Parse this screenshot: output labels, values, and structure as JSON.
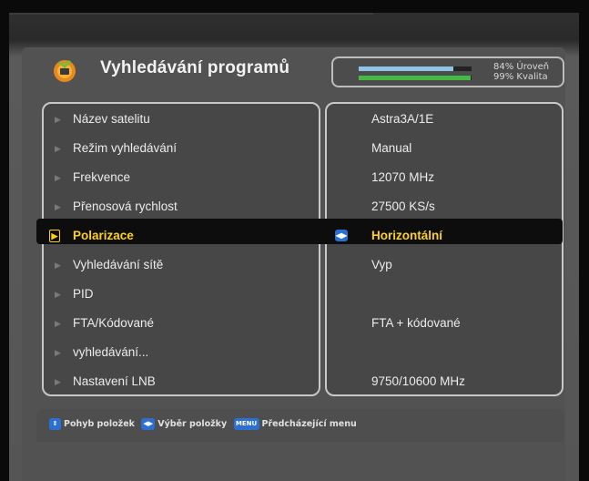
{
  "header": {
    "title": "Vyhledávání programů",
    "logo_icon": "tv-logo-icon"
  },
  "signal": {
    "level_percent": 84,
    "level_label": "84% Úroveň",
    "quality_percent": 99,
    "quality_label": "99% Kvalita",
    "level_color": "#8fc3e8",
    "quality_color": "#44b944"
  },
  "menu": {
    "selected_index": 4,
    "items": [
      {
        "label": "Název satelitu",
        "value": "Astra3A/1E"
      },
      {
        "label": "Režim vyhledávání",
        "value": "Manual"
      },
      {
        "label": "Frekvence",
        "value": "12070 MHz"
      },
      {
        "label": "Přenosová rychlost",
        "value": "27500 KS/s"
      },
      {
        "label": "Polarizace",
        "value": "Horizontální"
      },
      {
        "label": "Vyhledávání sítě",
        "value": "Vyp"
      },
      {
        "label": "PID",
        "value": ""
      },
      {
        "label": "FTA/Kódované",
        "value": "FTA + kódované"
      },
      {
        "label": "vyhledávání...",
        "value": ""
      },
      {
        "label": "Nastavení LNB",
        "value": "9750/10600 MHz"
      }
    ]
  },
  "help": {
    "move_label": "Pohyb položek",
    "select_label": "Výběr položky",
    "menu_key": "MENU",
    "back_label": "Předcházející menu"
  },
  "colors": {
    "selected_text": "#ffd21a",
    "key_blue": "#2b6fd0"
  }
}
